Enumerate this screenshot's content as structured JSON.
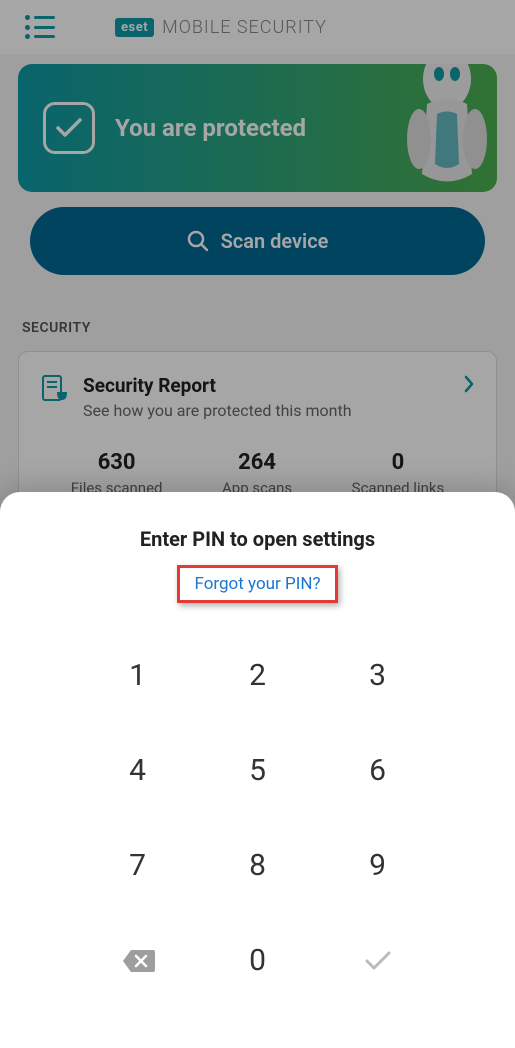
{
  "header": {
    "brand_badge": "eset",
    "brand_text": "MOBILE SECURITY"
  },
  "protected": {
    "status_text": "You are protected"
  },
  "scan": {
    "label": "Scan device"
  },
  "section": {
    "security_label": "SECURITY"
  },
  "report": {
    "title": "Security Report",
    "subtitle": "See how you are protected this month",
    "stats": [
      {
        "value": "630",
        "label": "Files scanned"
      },
      {
        "value": "264",
        "label": "App scans"
      },
      {
        "value": "0",
        "label": "Scanned links"
      }
    ]
  },
  "pin": {
    "title": "Enter PIN to open settings",
    "forgot": "Forgot your PIN?",
    "keys": {
      "k1": "1",
      "k2": "2",
      "k3": "3",
      "k4": "4",
      "k5": "5",
      "k6": "6",
      "k7": "7",
      "k8": "8",
      "k9": "9",
      "k0": "0"
    }
  }
}
